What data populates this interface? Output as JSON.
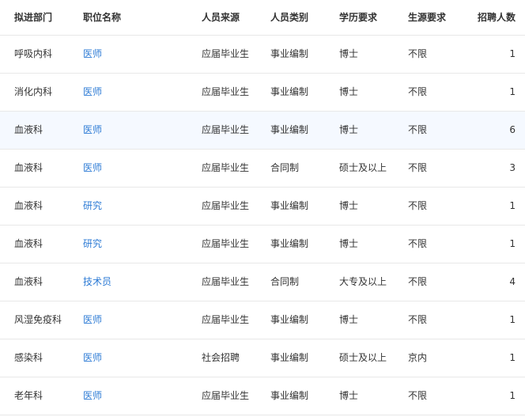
{
  "table": {
    "headers": [
      "拟进部门",
      "职位名称",
      "人员来源",
      "人员类别",
      "学历要求",
      "生源要求",
      "招聘人数"
    ],
    "rows": [
      {
        "dept": "呼吸内科",
        "position": "医师",
        "source": "应届毕业生",
        "category": "事业编制",
        "education": "博士",
        "origin": "不限",
        "count": "1"
      },
      {
        "dept": "消化内科",
        "position": "医师",
        "source": "应届毕业生",
        "category": "事业编制",
        "education": "博士",
        "origin": "不限",
        "count": "1"
      },
      {
        "dept": "血液科",
        "position": "医师",
        "source": "应届毕业生",
        "category": "事业编制",
        "education": "博士",
        "origin": "不限",
        "count": "6"
      },
      {
        "dept": "血液科",
        "position": "医师",
        "source": "应届毕业生",
        "category": "合同制",
        "education": "硕士及以上",
        "origin": "不限",
        "count": "3"
      },
      {
        "dept": "血液科",
        "position": "研究",
        "source": "应届毕业生",
        "category": "事业编制",
        "education": "博士",
        "origin": "不限",
        "count": "1"
      },
      {
        "dept": "血液科",
        "position": "研究",
        "source": "应届毕业生",
        "category": "事业编制",
        "education": "博士",
        "origin": "不限",
        "count": "1"
      },
      {
        "dept": "血液科",
        "position": "技术员",
        "source": "应届毕业生",
        "category": "合同制",
        "education": "大专及以上",
        "origin": "不限",
        "count": "4"
      },
      {
        "dept": "风湿免疫科",
        "position": "医师",
        "source": "应届毕业生",
        "category": "事业编制",
        "education": "博士",
        "origin": "不限",
        "count": "1"
      },
      {
        "dept": "感染科",
        "position": "医师",
        "source": "社会招聘",
        "category": "事业编制",
        "education": "硕士及以上",
        "origin": "京内",
        "count": "1"
      },
      {
        "dept": "老年科",
        "position": "医师",
        "source": "应届毕业生",
        "category": "事业编制",
        "education": "博士",
        "origin": "不限",
        "count": "1"
      }
    ]
  },
  "colors": {
    "link": "#2d7bd5",
    "border": "#e8e8e8",
    "hover_row": "#f5f9ff"
  }
}
